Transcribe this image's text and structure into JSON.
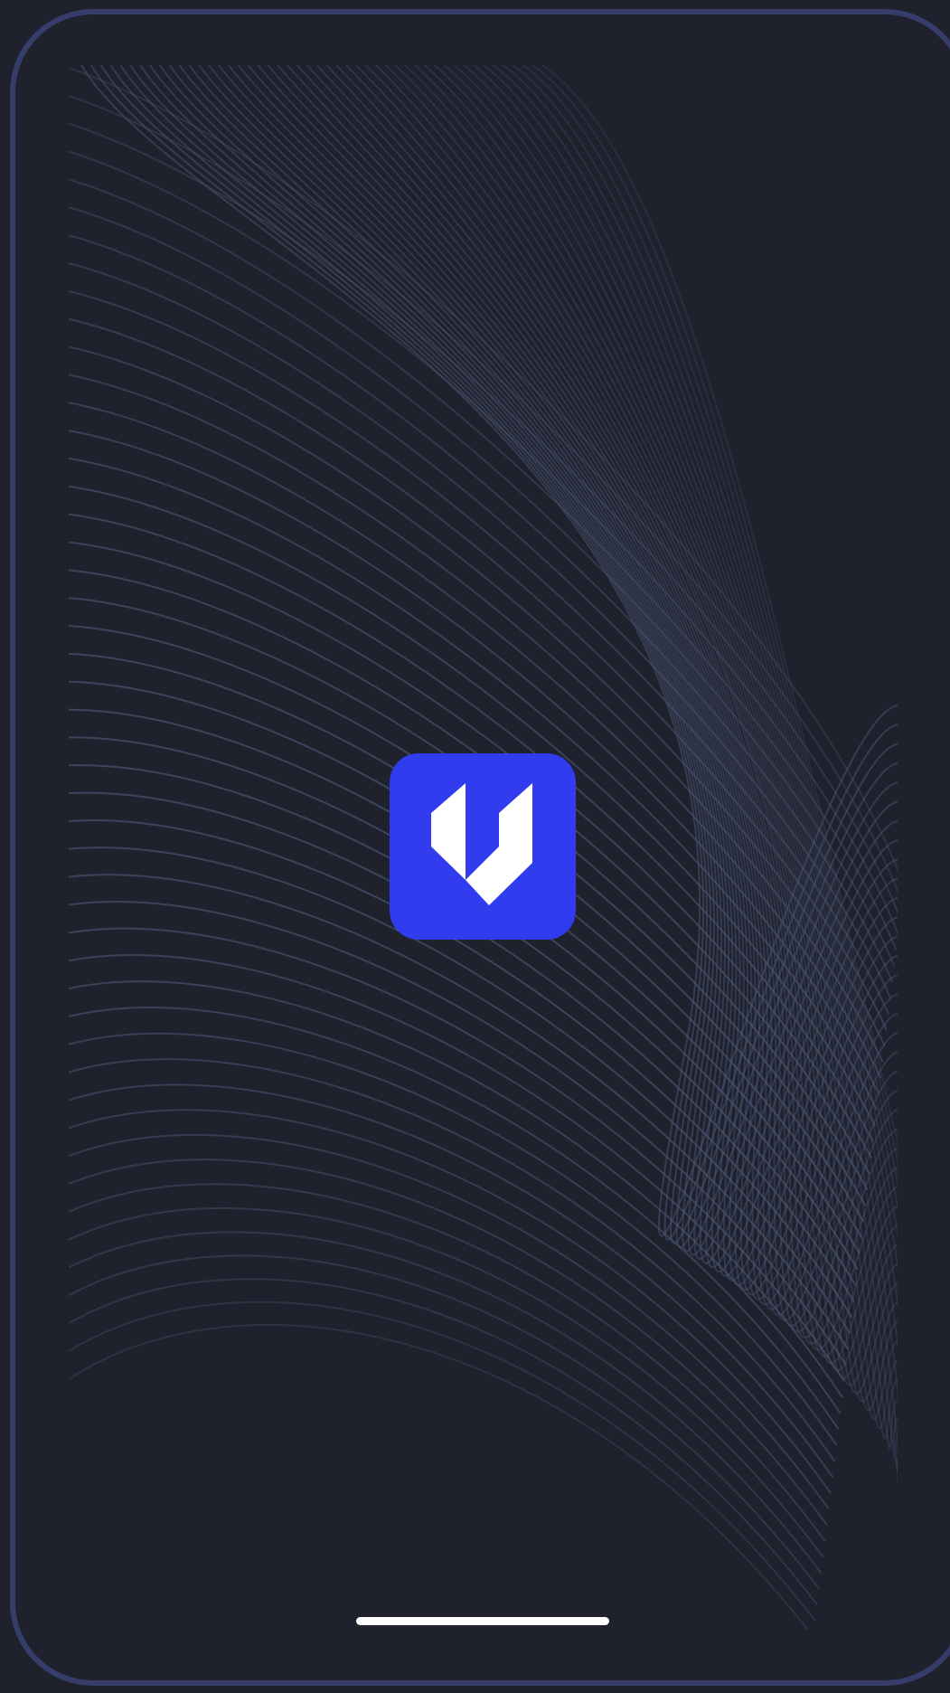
{
  "app": {
    "logo_icon": "app-logo-icon",
    "logo_color": "#303cee",
    "glyph_color": "#ffffff"
  },
  "background": {
    "color": "#1f212d",
    "frame_color": "#363d6b",
    "line_color": "#4a5570"
  },
  "home_indicator": {
    "color": "#ffffff"
  }
}
